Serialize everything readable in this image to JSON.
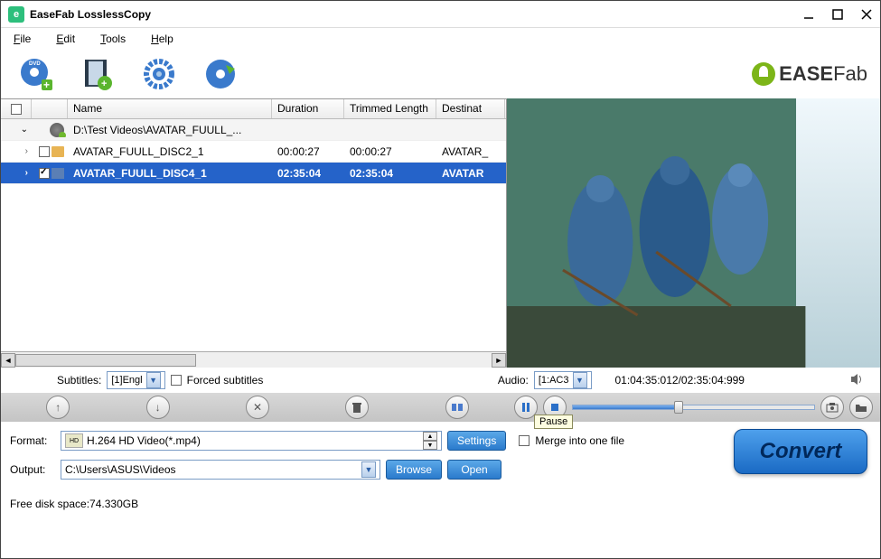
{
  "window": {
    "title": "EaseFab LosslessCopy"
  },
  "menubar": {
    "file": "File",
    "edit": "Edit",
    "tools": "Tools",
    "help": "Help"
  },
  "brand": {
    "ease": "EASE",
    "fab": "Fab"
  },
  "columns": {
    "name": "Name",
    "duration": "Duration",
    "trimmed": "Trimmed Length",
    "destination": "Destinat"
  },
  "rows": {
    "parent": {
      "name": "D:\\Test Videos\\AVATAR_FUULL_..."
    },
    "r1": {
      "name": "AVATAR_FUULL_DISC2_1",
      "duration": "00:00:27",
      "trimmed": "00:00:27",
      "dest": "AVATAR_"
    },
    "r2": {
      "name": "AVATAR_FUULL_DISC4_1",
      "duration": "02:35:04",
      "trimmed": "02:35:04",
      "dest": "AVATAR"
    }
  },
  "subs": {
    "label": "Subtitles:",
    "value": "[1]Engl",
    "forced": "Forced subtitles"
  },
  "audio": {
    "label": "Audio:",
    "value": "[1:AC3"
  },
  "time": "01:04:35:012/02:35:04:999",
  "tooltip": "Pause",
  "format": {
    "label": "Format:",
    "value": "H.264 HD Video(*.mp4)"
  },
  "settings_btn": "Settings",
  "merge": "Merge into one file",
  "output": {
    "label": "Output:",
    "value": "C:\\Users\\ASUS\\Videos"
  },
  "browse_btn": "Browse",
  "open_btn": "Open",
  "convert_btn": "Convert",
  "footer": "Free disk space:74.330GB"
}
